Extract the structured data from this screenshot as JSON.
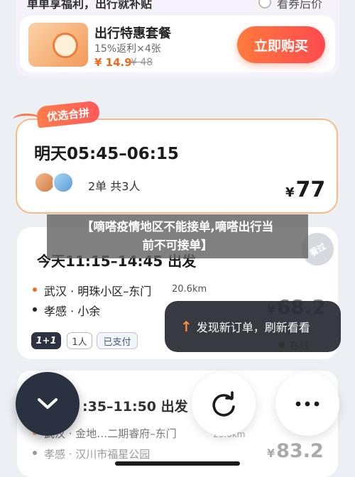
{
  "promo": {
    "top_left_text": "单单享福利，出行就补贴",
    "top_right_text": "看券后价",
    "title": "出行特惠套餐",
    "subtitle": "15%返利×4张",
    "price": "¥ 14.9",
    "old_price": "¥ 48",
    "buy_label": "立即购买"
  },
  "carpool": {
    "tag": "优选合拼",
    "time": "明天05:45–06:15",
    "summary": "2单 共3人",
    "currency": "¥",
    "price": "77"
  },
  "banner": {
    "line1": "【嘀嗒疫情地区不能接单,嘀嗒出行当",
    "line2": "前不可接单】"
  },
  "order": {
    "stamp": "看过",
    "time": "今天11:15–14:45 出发",
    "from": "武汉 · 明珠小区–东门",
    "from_distance": "20.6km",
    "to": "孝感 · 小余",
    "currency": "¥",
    "price": "68.2",
    "chip_pool": "1+1",
    "chip_people": "1人",
    "chip_paid": "已支付"
  },
  "toast": {
    "icon": "↑",
    "text": "发现新订单，刷新看看",
    "online": "在线"
  },
  "order3": {
    "time": ":35–11:50 出发",
    "from": "武汉 · 金地…二期睿府–东门",
    "from_distance": "23.0km",
    "to": "孝感 · 汉川市福星公园",
    "currency": "¥",
    "price": "83.2"
  }
}
